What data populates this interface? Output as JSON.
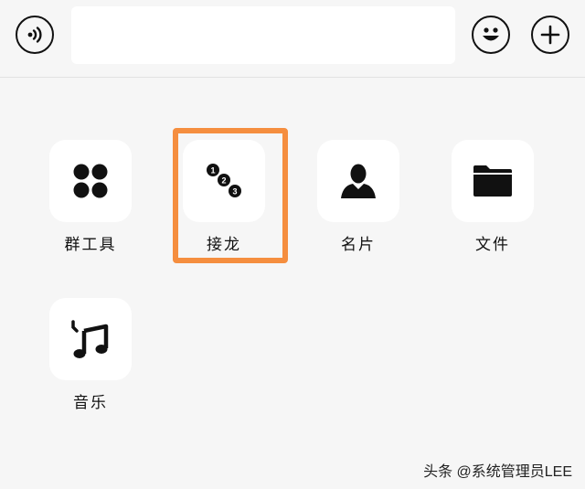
{
  "input_bar": {
    "value": ""
  },
  "icons": {
    "voice": "voice-icon",
    "emoji": "emoji-icon",
    "plus": "plus-icon"
  },
  "panel": {
    "items": [
      {
        "label": "群工具",
        "icon": "grid-icon"
      },
      {
        "label": "接龙",
        "icon": "chain-icon",
        "number_badges": [
          "1",
          "2",
          "3"
        ]
      },
      {
        "label": "名片",
        "icon": "person-icon"
      },
      {
        "label": "文件",
        "icon": "folder-icon"
      },
      {
        "label": "音乐",
        "icon": "music-note-icon"
      }
    ]
  },
  "highlight_color": "#f58e3f",
  "watermark": "头条 @系统管理员LEE"
}
